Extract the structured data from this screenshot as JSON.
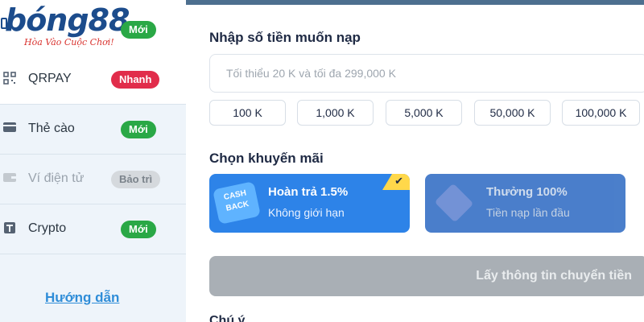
{
  "brand": {
    "logo_text": "bóng88",
    "slogan": "Hòa Vào Cuộc Chơi!",
    "new_badge": "Mới"
  },
  "sidebar": {
    "items": [
      {
        "label": "QRPAY",
        "badge": "Nhanh",
        "icon": "qr-code-icon"
      },
      {
        "label": "Thẻ cào",
        "badge": "Mới",
        "icon": "card-icon"
      },
      {
        "label": "Ví điện tử",
        "badge": "Bảo trì",
        "icon": "wallet-icon"
      },
      {
        "label": "Crypto",
        "badge": "Mới",
        "icon": "crypto-icon"
      }
    ],
    "guide_link": "Hướng dẫn"
  },
  "deposit": {
    "amount_title": "Nhập số tiền muốn nạp",
    "amount_placeholder": "Tối thiểu 20 K và tối đa 299,000 K",
    "quick_amounts": [
      "100 K",
      "1,000 K",
      "5,000 K",
      "50,000 K",
      "100,000 K"
    ],
    "promo_title": "Chọn khuyến mãi",
    "promos": [
      {
        "title": "Hoàn trả 1.5%",
        "subtitle": "Không giới hạn",
        "art_text": "CASH BACK",
        "selected": true
      },
      {
        "title": "Thưởng 100%",
        "subtitle": "Tiền nạp lần đầu",
        "selected": false
      }
    ],
    "submit_label": "Lấy thông tin chuyển tiền",
    "note_label": "Chú ý"
  },
  "colors": {
    "accent_blue": "#2d83e8",
    "badge_green": "#2aa846",
    "badge_red": "#e12d4b",
    "disabled_button": "#a9afb5"
  }
}
